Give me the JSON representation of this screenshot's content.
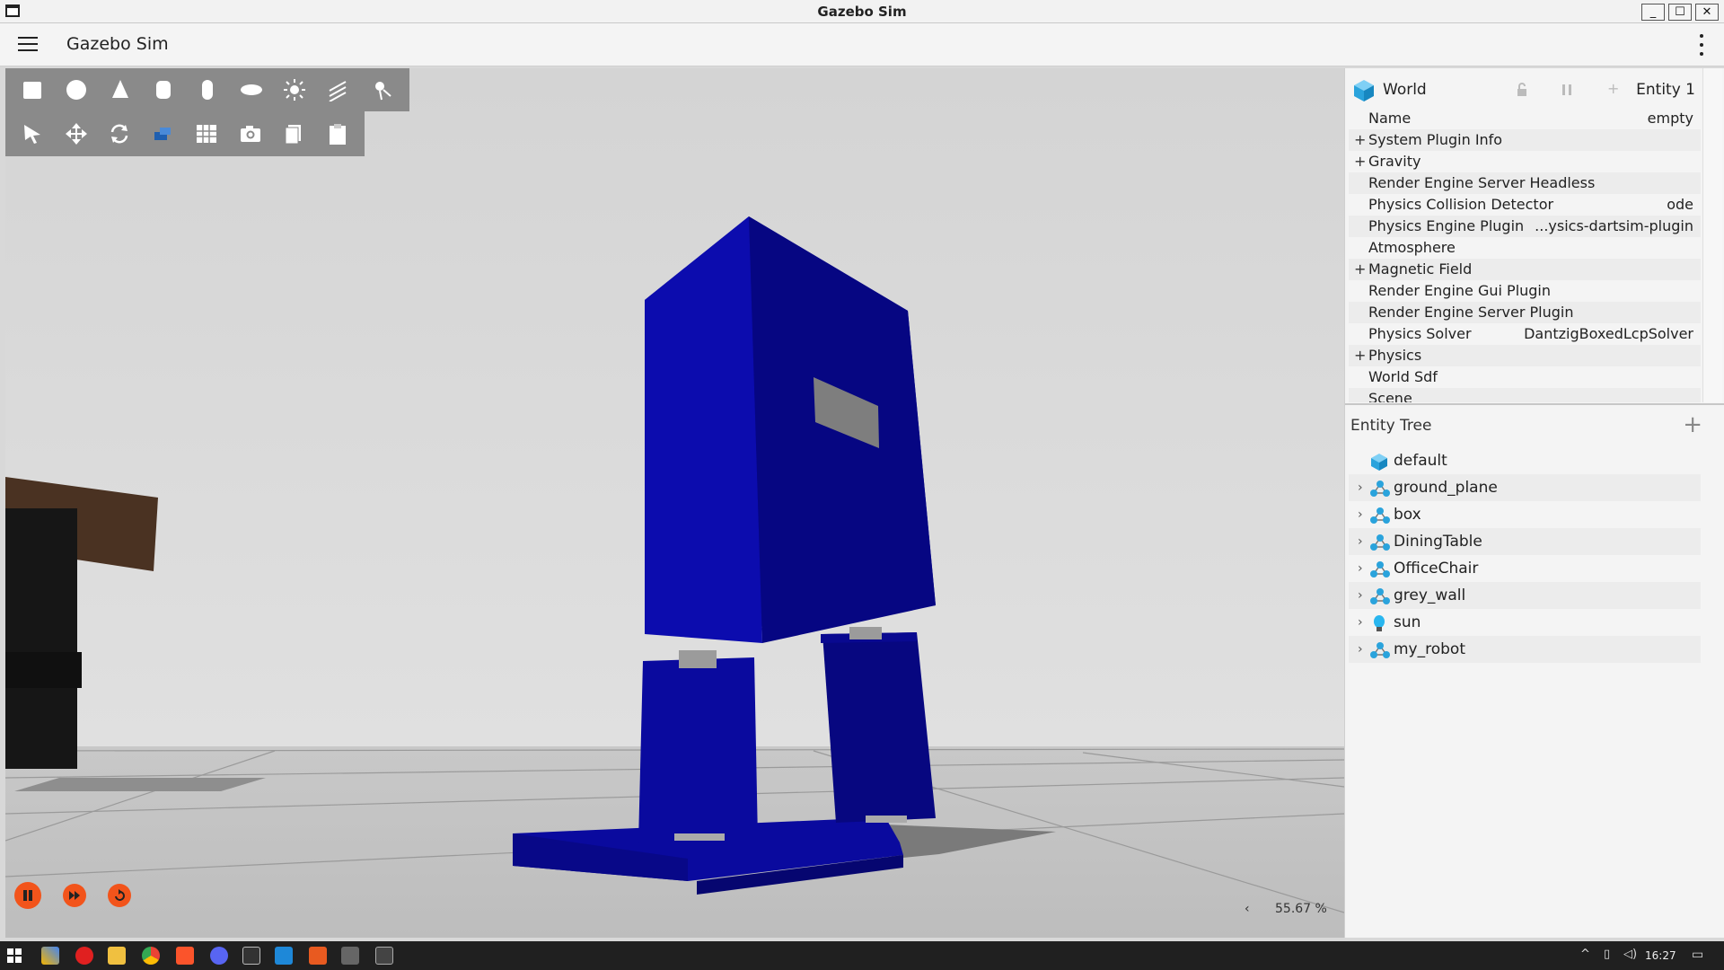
{
  "window": {
    "title": "Gazebo Sim"
  },
  "header": {
    "title": "Gazebo Sim"
  },
  "shape_toolbar": {
    "tools": [
      "box-tool",
      "sphere-tool",
      "cone-tool",
      "cylinder-tool",
      "capsule-tool",
      "ellipsoid-tool",
      "point-light-tool",
      "directional-light-tool",
      "spot-light-tool"
    ]
  },
  "transform_toolbar": {
    "tools": [
      "select-tool",
      "translate-tool",
      "rotate-tool",
      "view-angle-tool",
      "grid-snap-tool",
      "screenshot-tool",
      "copy-tool",
      "paste-tool"
    ]
  },
  "playback": {
    "rtf_value": "55.67 %",
    "rtf_arrow": "‹"
  },
  "component_inspector": {
    "entity_label": "World",
    "entity_id": "Entity 1",
    "rows": [
      {
        "expandable": false,
        "label": "Name",
        "value": "empty"
      },
      {
        "expandable": true,
        "label": "System Plugin Info",
        "value": ""
      },
      {
        "expandable": true,
        "label": "Gravity",
        "value": ""
      },
      {
        "expandable": false,
        "label": "Render Engine Server Headless",
        "value": ""
      },
      {
        "expandable": false,
        "label": "Physics Collision Detector",
        "value": "ode"
      },
      {
        "expandable": false,
        "label": "Physics Engine Plugin",
        "value": "...ysics-dartsim-plugin"
      },
      {
        "expandable": false,
        "label": "Atmosphere",
        "value": ""
      },
      {
        "expandable": true,
        "label": "Magnetic Field",
        "value": ""
      },
      {
        "expandable": false,
        "label": "Render Engine Gui Plugin",
        "value": ""
      },
      {
        "expandable": false,
        "label": "Render Engine Server Plugin",
        "value": ""
      },
      {
        "expandable": false,
        "label": "Physics Solver",
        "value": "DantzigBoxedLcpSolver"
      },
      {
        "expandable": true,
        "label": "Physics",
        "value": ""
      },
      {
        "expandable": false,
        "label": "World Sdf",
        "value": ""
      },
      {
        "expandable": false,
        "label": "Scene",
        "value": ""
      }
    ]
  },
  "entity_tree": {
    "title": "Entity Tree",
    "add_label": "+",
    "items": [
      {
        "name": "default",
        "icon": "world-icon",
        "has_children": false
      },
      {
        "name": "ground_plane",
        "icon": "model-icon",
        "has_children": true
      },
      {
        "name": "box",
        "icon": "model-icon",
        "has_children": true
      },
      {
        "name": "DiningTable",
        "icon": "model-icon",
        "has_children": true
      },
      {
        "name": "OfficeChair",
        "icon": "model-icon",
        "has_children": true
      },
      {
        "name": "grey_wall",
        "icon": "model-icon",
        "has_children": true
      },
      {
        "name": "sun",
        "icon": "light-icon",
        "has_children": true
      },
      {
        "name": "my_robot",
        "icon": "model-icon",
        "has_children": true
      }
    ]
  },
  "taskbar": {
    "clock": "16:27"
  },
  "colors": {
    "accent_play": "#f2541b",
    "robot_blue": "#0a0a9e",
    "toolbar_gray": "#8a8a8a"
  }
}
